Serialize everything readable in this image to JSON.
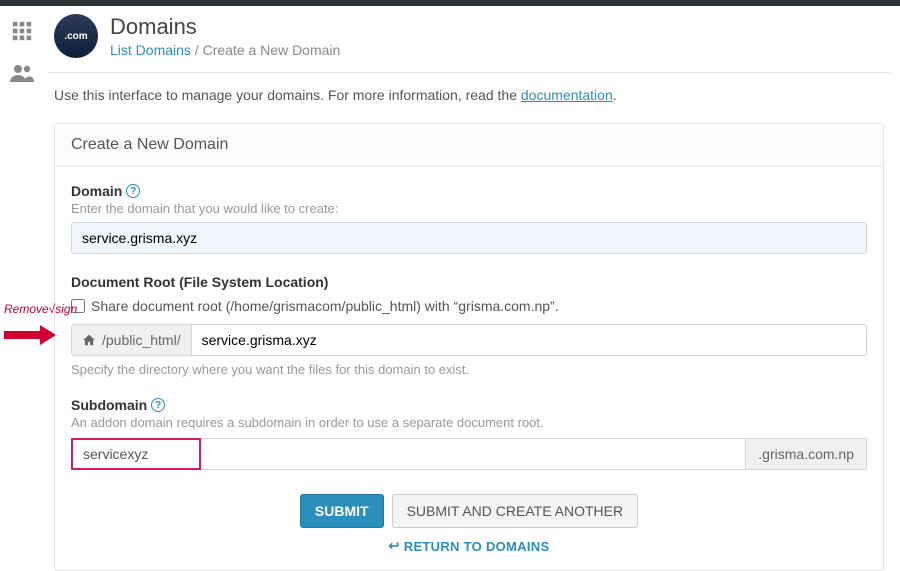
{
  "page": {
    "icon_text": ".com",
    "title": "Domains",
    "breadcrumb": {
      "link": "List Domains",
      "sep": " / ",
      "current": "Create a New Domain"
    },
    "intro_pre": "Use this interface to manage your domains. For more information, read the ",
    "intro_link": "documentation",
    "intro_post": "."
  },
  "card": {
    "title": "Create a New Domain"
  },
  "domain": {
    "label": "Domain",
    "hint": "Enter the domain that you would like to create:",
    "value": "service.grisma.xyz"
  },
  "docroot": {
    "label": "Document Root (File System Location)",
    "checkbox_label": "Share document root (/home/grismacom/public_html) with “grisma.com.np”.",
    "addon": "/public_html/",
    "value": "service.grisma.xyz",
    "hint": "Specify the directory where you want the files for this domain to exist."
  },
  "subdomain": {
    "label": "Subdomain",
    "hint": "An addon domain requires a subdomain in order to use a separate document root.",
    "value": "servicexyz",
    "suffix": ".grisma.com.np"
  },
  "actions": {
    "submit": "SUBMIT",
    "submit_another": "SUBMIT AND CREATE ANOTHER",
    "return": "RETURN TO DOMAINS"
  },
  "annotation": "Remove√sign"
}
